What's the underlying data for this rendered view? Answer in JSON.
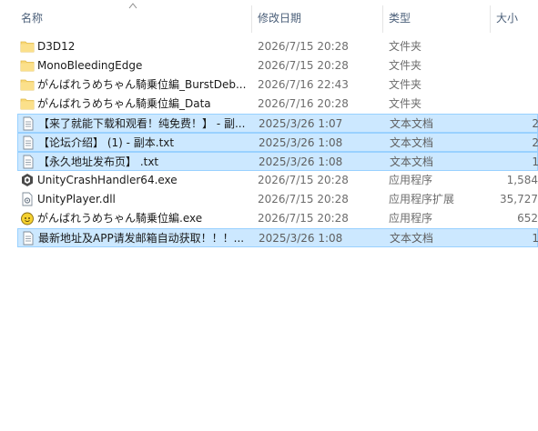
{
  "columns": {
    "name": "名称",
    "date": "修改日期",
    "type": "类型",
    "size": "大小"
  },
  "files": [
    {
      "name": "D3D12",
      "date": "2026/7/15 20:28",
      "type": "文件夹",
      "size": "",
      "icon": "folder-icon",
      "selected": false
    },
    {
      "name": "MonoBleedingEdge",
      "date": "2026/7/15 20:28",
      "type": "文件夹",
      "size": "",
      "icon": "folder-icon",
      "selected": false
    },
    {
      "name": "がんばれうめちゃん騎乗位編_BurstDeb...",
      "date": "2026/7/16 22:43",
      "type": "文件夹",
      "size": "",
      "icon": "folder-icon",
      "selected": false
    },
    {
      "name": "がんばれうめちゃん騎乗位編_Data",
      "date": "2026/7/16 20:28",
      "type": "文件夹",
      "size": "",
      "icon": "folder-icon",
      "selected": false
    },
    {
      "name": "【来了就能下载和观看！纯免费！】 - 副...",
      "date": "2025/3/26 1:07",
      "type": "文本文档",
      "size": "2",
      "icon": "text-file-icon",
      "selected": true
    },
    {
      "name": "【论坛介绍】 (1) - 副本.txt",
      "date": "2025/3/26 1:08",
      "type": "文本文档",
      "size": "2",
      "icon": "text-file-icon",
      "selected": true
    },
    {
      "name": "【永久地址发布页】 .txt",
      "date": "2025/3/26 1:08",
      "type": "文本文档",
      "size": "1",
      "icon": "text-file-icon",
      "selected": true
    },
    {
      "name": "UnityCrashHandler64.exe",
      "date": "2026/7/15 20:28",
      "type": "应用程序",
      "size": "1,584",
      "icon": "unity-app-icon",
      "selected": false
    },
    {
      "name": "UnityPlayer.dll",
      "date": "2026/7/15 20:28",
      "type": "应用程序扩展",
      "size": "35,727",
      "icon": "dll-file-icon",
      "selected": false
    },
    {
      "name": "がんばれうめちゃん騎乗位編.exe",
      "date": "2026/7/15 20:28",
      "type": "应用程序",
      "size": "652",
      "icon": "game-app-icon",
      "selected": false
    },
    {
      "name": "最新地址及APP请发邮箱自动获取！！！...",
      "date": "2025/3/26 1:08",
      "type": "文本文档",
      "size": "1",
      "icon": "text-file-icon",
      "selected": true
    }
  ],
  "colors": {
    "selection_fill": "#cce8ff",
    "selection_border": "#99d1ff",
    "header_text": "#4c607a",
    "folder": "#f8d775"
  }
}
